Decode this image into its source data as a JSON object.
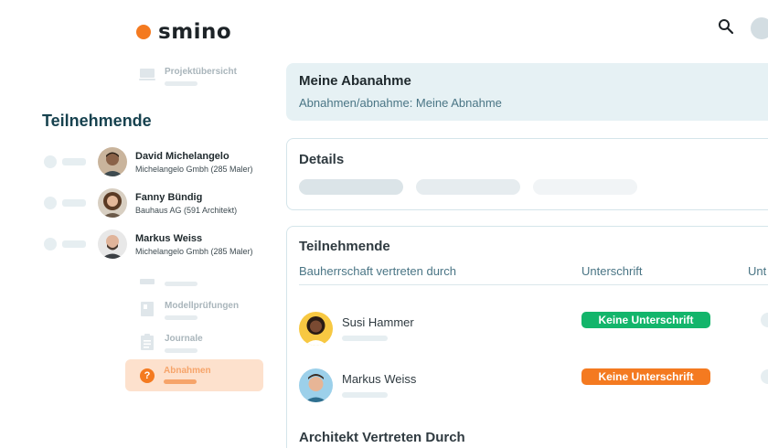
{
  "brand": {
    "name": "smino",
    "color": "#f47a20"
  },
  "topbar": {
    "search_icon": "search-icon",
    "avatar": "avatar"
  },
  "sidebar": {
    "nav_top": {
      "label": "Projektübersicht",
      "icon": "monitor-icon"
    },
    "title": "Teilnehmende",
    "participants": [
      {
        "name": "David Michelangelo",
        "company": "Michelangelo Gmbh (285 Maler)"
      },
      {
        "name": "Fanny Bündig",
        "company": "Bauhaus AG (591 Architekt)"
      },
      {
        "name": "Markus Weiss",
        "company": "Michelangelo Gmbh (285 Maler)"
      }
    ],
    "nav_items": [
      {
        "label": "",
        "icon": "image-icon"
      },
      {
        "label": "Modellprüfungen",
        "icon": "book-icon"
      },
      {
        "label": "Journale",
        "icon": "clipboard-icon"
      },
      {
        "label": "Abnahmen",
        "icon": "help-icon",
        "active": true
      }
    ]
  },
  "header": {
    "title": "Meine Abanahme",
    "breadcrumb": "Abnahmen/abnahme: Meine Abnahme"
  },
  "details": {
    "title": "Details"
  },
  "participants_table": {
    "title": "Teilnehmende",
    "columns": [
      "Bauherrschaft vertreten durch",
      "Unterschrift",
      "Unt"
    ],
    "rows": [
      {
        "name": "Susi Hammer",
        "status": "Keine Unterschrift",
        "status_color": "#13b56b"
      },
      {
        "name": "Markus Weiss",
        "status": "Keine Unterschrift",
        "status_color": "#f47a20"
      }
    ],
    "next_section": "Architekt Vertreten Durch"
  }
}
